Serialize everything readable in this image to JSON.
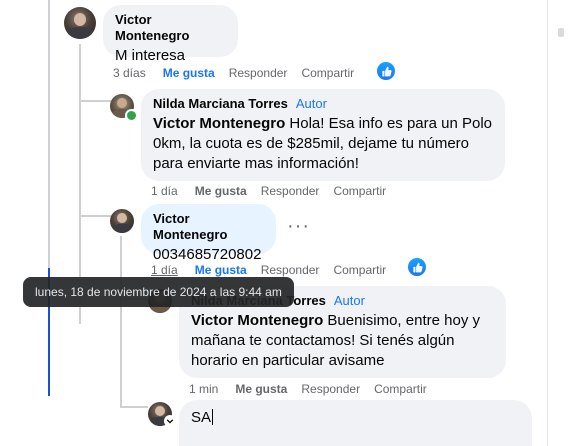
{
  "comments": [
    {
      "author": "Victor Montenegro",
      "text": "M interesa",
      "time": "3 días",
      "like": "Me gusta",
      "reply": "Responder",
      "share": "Compartir"
    },
    {
      "author": "Nilda Marciana Torres",
      "badge": "Autor",
      "mention": "Victor Montenegro",
      "text": " Hola! Esa info es para un Polo 0km, la cuota es de $285mil, dejame tu número para enviarte mas información!",
      "time": "1 día",
      "like": "Me gusta",
      "reply": "Responder",
      "share": "Compartir"
    },
    {
      "author": "Victor Montenegro",
      "text": "0034685720802",
      "time": "1 día",
      "like": "Me gusta",
      "reply": "Responder",
      "share": "Compartir",
      "more": "···"
    },
    {
      "author": "Nilda Marciana Torres",
      "badge": "Autor",
      "mention": "Victor Montenegro",
      "text": " Buenisimo, entre hoy y mañana te contactamos! Si tenés algún horario en particular avisame",
      "time": "1 min",
      "like": "Me gusta",
      "reply": "Responder",
      "share": "Compartir"
    }
  ],
  "tooltip": "lunes, 18 de noviembre de 2024 a las 9:44 am",
  "reply_box": {
    "value": "SA"
  },
  "colors": {
    "accent": "#1877f2",
    "bubble": "#f0f2f5",
    "muted": "#65676b"
  }
}
